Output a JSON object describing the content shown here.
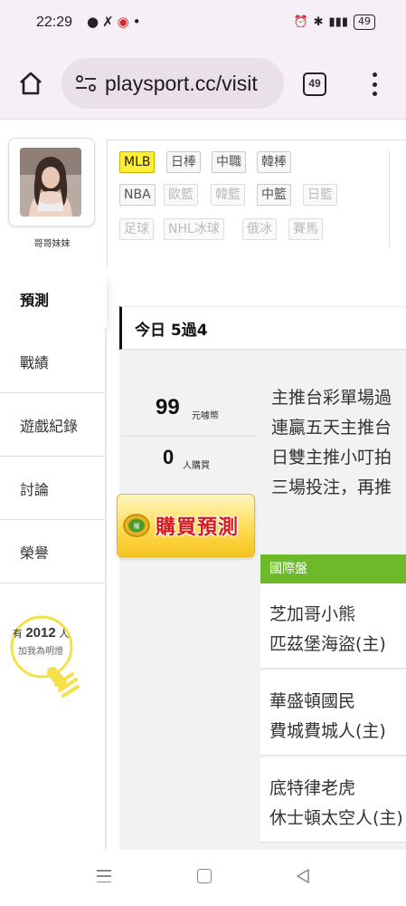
{
  "status_bar": {
    "time": "22:29",
    "left_icons": "● ✗ ◉ •",
    "right_icons": "⏰ ✱ ᵛᵒ 4G ▮▮▮",
    "battery": "49"
  },
  "browser": {
    "url": "playsport.cc/visit",
    "tab_count": "49"
  },
  "profile": {
    "name": "哥哥妹妹"
  },
  "side_nav": [
    {
      "label": "預測",
      "active": true
    },
    {
      "label": "戰績",
      "active": false
    },
    {
      "label": "遊戲紀錄",
      "active": false
    },
    {
      "label": "討論",
      "active": false
    },
    {
      "label": "榮譽",
      "active": false
    }
  ],
  "lamp": {
    "prefix": "有",
    "count": "2012",
    "suffix": "人",
    "caption": "加我為明燈"
  },
  "leagues": {
    "row1": [
      "MLB",
      "日棒",
      "中職",
      "韓棒"
    ],
    "row2": [
      "NBA",
      "歐籃",
      "韓籃",
      "中籃",
      "日籃"
    ],
    "row3": [
      "足球",
      "NHL冰球",
      "俄冰",
      "賽馬"
    ],
    "selected": "MLB"
  },
  "today": {
    "label": "今日 5過4"
  },
  "stats": {
    "coins": "99",
    "coins_unit": "元噱幣",
    "buyers": "0",
    "buyers_unit": "人購買"
  },
  "buy_button": {
    "label": "購買預測"
  },
  "description": [
    "主推台彩單場過",
    "連贏五天主推台",
    "日雙主推小叮拍",
    "三場投注，再推"
  ],
  "section_header": "國際盤",
  "matches": [
    {
      "away": "芝加哥小熊",
      "home": "匹茲堡海盜(主)"
    },
    {
      "away": "華盛頓國民",
      "home": "費城費城人(主)"
    },
    {
      "away": "底特律老虎",
      "home": "休士頓太空人(主)"
    }
  ],
  "colors": {
    "accent_green": "#6cba2a",
    "league_selected": "#ffee33",
    "buy_red": "#d61a1a",
    "browser_bg": "#f6eff7"
  }
}
